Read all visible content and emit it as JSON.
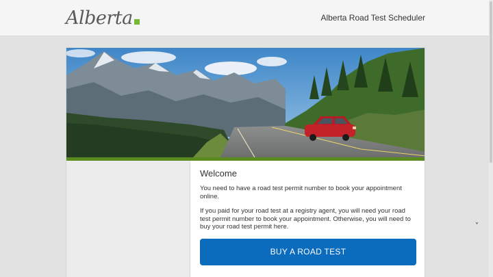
{
  "header": {
    "logo_text": "Alberta",
    "app_title": "Alberta Road Test Scheduler"
  },
  "hero": {
    "image_description_icon": "mountain-road-car-image"
  },
  "main": {
    "heading": "Welcome",
    "paragraph1": "You need to have a road test permit number to book your appointment online.",
    "paragraph2": "If you paid for your road test at a registry agent, you will need your road test permit number to book your appointment. Otherwise, you will need to buy your road test permit here.",
    "buy_button_label": "BUY A ROAD TEST"
  },
  "colors": {
    "accent": "#0b6bbd",
    "stripe": "#5b8a1f",
    "flag": "#77b83a"
  }
}
